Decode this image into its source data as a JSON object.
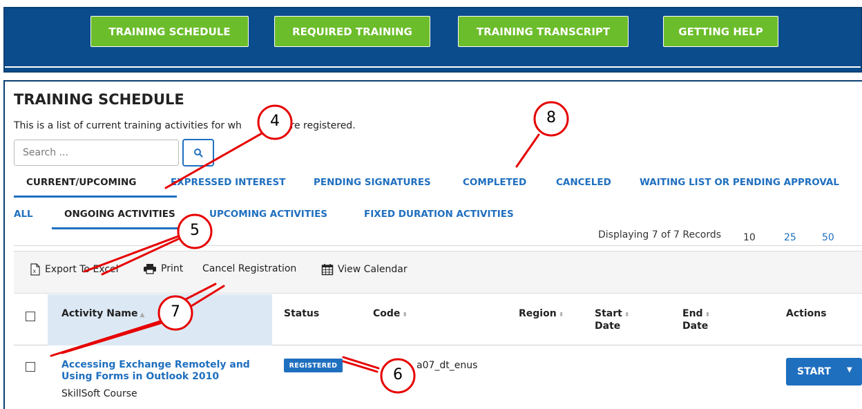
{
  "nav": {
    "buttons": [
      "TRAINING SCHEDULE",
      "REQUIRED TRAINING",
      "TRAINING TRANSCRIPT",
      "GETTING HELP"
    ]
  },
  "page": {
    "title": "TRAINING SCHEDULE",
    "description": "This is a list of current training activities for wh",
    "description_tail": "are registered."
  },
  "search": {
    "placeholder": "Search ...",
    "icon": "search-icon"
  },
  "tabs": [
    "CURRENT/UPCOMING",
    "EXPRESSED INTEREST",
    "PENDING SIGNATURES",
    "COMPLETED",
    "CANCELED",
    "WAITING LIST OR PENDING APPROVAL"
  ],
  "subtabs": [
    "ALL",
    "ONGOING ACTIVITIES",
    "UPCOMING ACTIVITIES",
    "FIXED DURATION ACTIVITIES"
  ],
  "records": {
    "info": "Displaying 7 of 7 Records",
    "page_sizes": [
      "10",
      "25",
      "50"
    ]
  },
  "toolbar": {
    "export": "Export To Excel",
    "print": "Print",
    "cancel": "Cancel Registration",
    "calendar": "View Calendar"
  },
  "table": {
    "headers": {
      "activity": "Activity Name",
      "status": "Status",
      "code": "Code",
      "region": "Region",
      "start_1": "Start",
      "start_2": "Date",
      "end_1": "End",
      "end_2": "Date",
      "actions": "Actions"
    },
    "rows": [
      {
        "name_line1": "Accessing Exchange Remotely and",
        "name_line2": "Using Forms in Outlook 2010",
        "type": "SkillSoft Course",
        "status": "REGISTERED",
        "code": "a07_dt_enus",
        "action": "START"
      }
    ]
  },
  "callouts": [
    "4",
    "5",
    "6",
    "7",
    "8"
  ],
  "colors": {
    "nav_bg": "#0b4c8c",
    "nav_button": "#6cbd2b",
    "link_blue": "#1f6fbf",
    "sorted_col_bg": "#dce9f5",
    "callout_red": "#e60000"
  }
}
